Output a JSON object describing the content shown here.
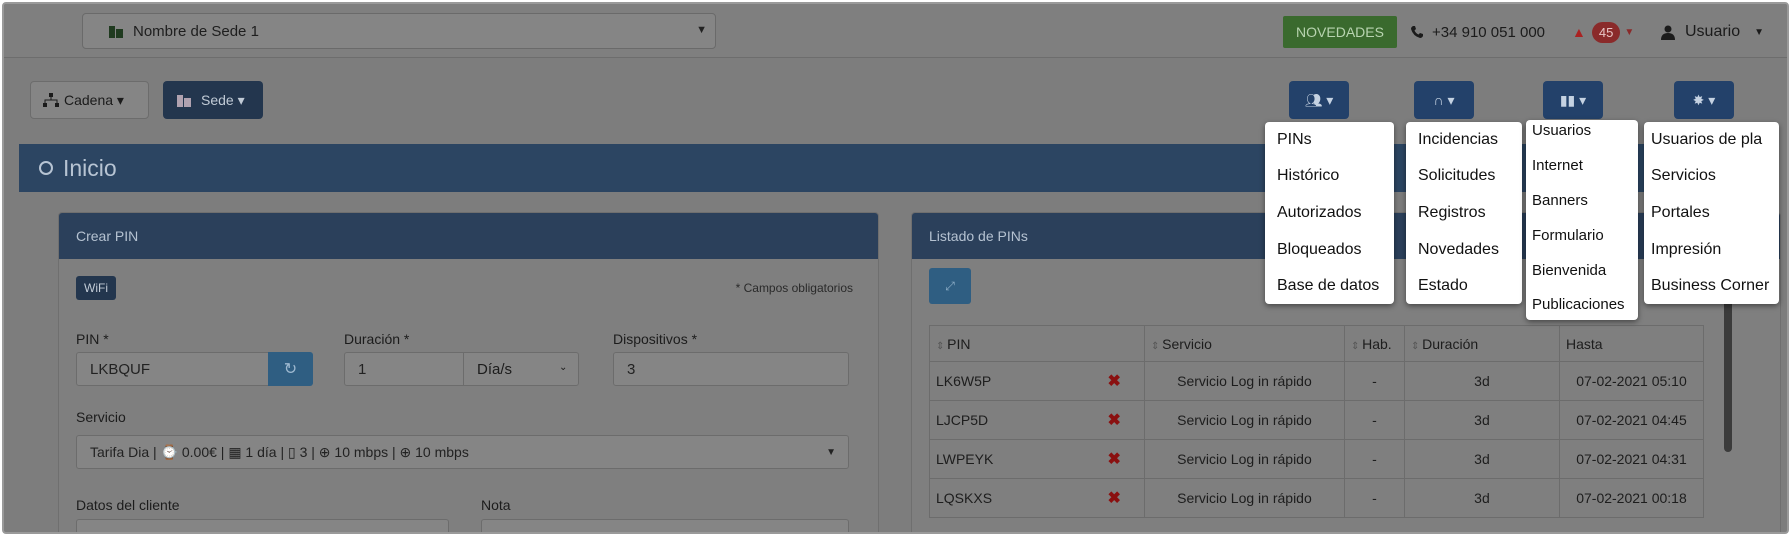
{
  "topbar": {
    "sede_name": "Nombre de Sede 1",
    "novedades": "NOVEDADES",
    "phone": "+34 910 051 000",
    "notif_count": "45",
    "user": "Usuario"
  },
  "toolbar": {
    "cadena": "Cadena ▾",
    "sede": "Sede ▾"
  },
  "page_title": "Inicio",
  "crear_pin": {
    "title": "Crear PIN",
    "wifi_tag": "WiFi",
    "required_note": "* Campos obligatorios",
    "pin_label": "PIN *",
    "pin_value": "LKBQUF",
    "duracion_label": "Duración *",
    "duracion_value": "1",
    "duracion_unit": "Día/s",
    "dispositivos_label": "Dispositivos *",
    "dispositivos_value": "3",
    "servicio_label": "Servicio",
    "servicio_value": "Tarifa Dia | ⌚ 0.00€ | ▦ 1 día | ▯ 3 | ⊕ 10 mbps | ⊕ 10 mbps",
    "datos_label": "Datos del cliente",
    "nota_label": "Nota"
  },
  "listado": {
    "title": "Listado de PINs",
    "headers": [
      "PIN",
      "Servicio",
      "Hab.",
      "Duración",
      "Hasta"
    ],
    "rows": [
      {
        "pin": "LK6W5P",
        "servicio": "Servicio Log in rápido",
        "hab": "-",
        "duracion": "3d",
        "hasta": "07-02-2021 05:10"
      },
      {
        "pin": "LJCP5D",
        "servicio": "Servicio Log in rápido",
        "hab": "-",
        "duracion": "3d",
        "hasta": "07-02-2021 04:45"
      },
      {
        "pin": "LWPEYK",
        "servicio": "Servicio Log in rápido",
        "hab": "-",
        "duracion": "3d",
        "hasta": "07-02-2021 04:31"
      },
      {
        "pin": "LQSKXS",
        "servicio": "Servicio Log in rápido",
        "hab": "-",
        "duracion": "3d",
        "hasta": "07-02-2021 00:18"
      }
    ]
  },
  "menus": {
    "users": [
      "PINs",
      "Histórico",
      "Autorizados",
      "Bloqueados",
      "Base de datos"
    ],
    "support": [
      "Incidencias",
      "Solicitudes",
      "Registros",
      "Novedades",
      "Estado"
    ],
    "stats": [
      "Usuarios",
      "Internet",
      "Banners",
      "Formulario",
      "Bienvenida",
      "Publicaciones"
    ],
    "settings": [
      "Usuarios de pla",
      "Servicios",
      "Portales",
      "Impresión",
      "Business Corner"
    ]
  },
  "colors": {
    "overlay_bg": "#7f7f7f",
    "header_blue": "#2c4562",
    "button_blue": "#23416a",
    "novedades_green": "#3a6a2e",
    "badge_red": "#8a2a2a"
  }
}
